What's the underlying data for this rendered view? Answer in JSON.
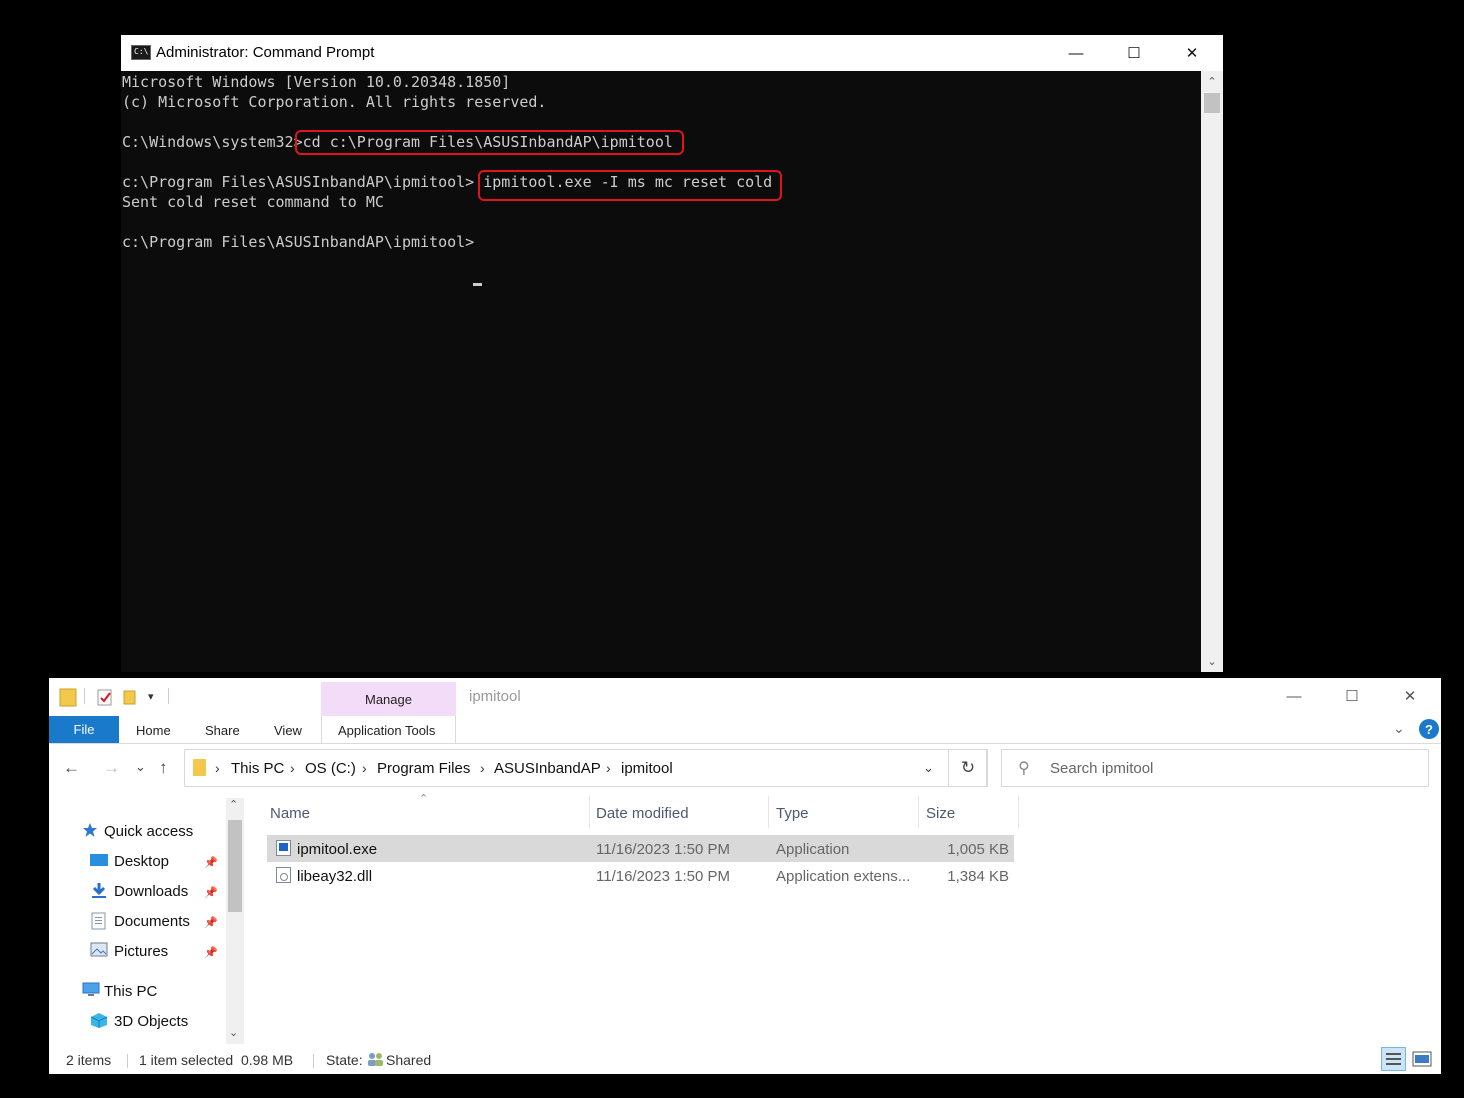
{
  "cmd": {
    "title": "Administrator: Command Prompt",
    "icon_text": "C:\\",
    "controls": {
      "minimize": "—",
      "maximize": "☐",
      "close": "✕"
    },
    "lines": [
      "Microsoft Windows [Version 10.0.20348.1850]",
      "(c) Microsoft Corporation. All rights reserved.",
      "",
      "C:\\Windows\\system32>cd c:\\Program Files\\ASUSInbandAP\\ipmitool",
      "",
      "c:\\Program Files\\ASUSInbandAP\\ipmitool> ipmitool.exe -I ms mc reset cold",
      "Sent cold reset command to MC",
      "",
      "c:\\Program Files\\ASUSInbandAP\\ipmitool>"
    ],
    "highlight_color": "#e0141e"
  },
  "explorer": {
    "window_title": "ipmitool",
    "contextual_tab_group": "Manage",
    "tabs": {
      "file": "File",
      "home": "Home",
      "share": "Share",
      "view": "View",
      "app_tools": "Application Tools"
    },
    "help": "?",
    "nav": {
      "back": "←",
      "forward": "→",
      "recent": "⌄",
      "up": "↑"
    },
    "breadcrumb": [
      "This PC",
      "OS (C:)",
      "Program Files",
      "ASUSInbandAP",
      "ipmitool"
    ],
    "breadcrumb_sep": "›",
    "refresh": "↻",
    "search_placeholder": "Search ipmitool",
    "nav_pane": {
      "quick_access": "Quick access",
      "items": [
        "Desktop",
        "Downloads",
        "Documents",
        "Pictures"
      ],
      "this_pc": "This PC",
      "objects_3d": "3D Objects"
    },
    "columns": {
      "name": "Name",
      "date": "Date modified",
      "type": "Type",
      "size": "Size"
    },
    "files": [
      {
        "name": "ipmitool.exe",
        "date": "11/16/2023 1:50 PM",
        "type": "Application",
        "size": "1,005 KB",
        "icon": "exe-icon",
        "selected": true
      },
      {
        "name": "libeay32.dll",
        "date": "11/16/2023 1:50 PM",
        "type": "Application extens...",
        "size": "1,384 KB",
        "icon": "dll-icon",
        "selected": false
      }
    ],
    "status": {
      "items": "2 items",
      "selected": "1 item selected  0.98 MB",
      "state_label": "State:",
      "state_value": "Shared"
    },
    "accent": "#1979ca"
  }
}
